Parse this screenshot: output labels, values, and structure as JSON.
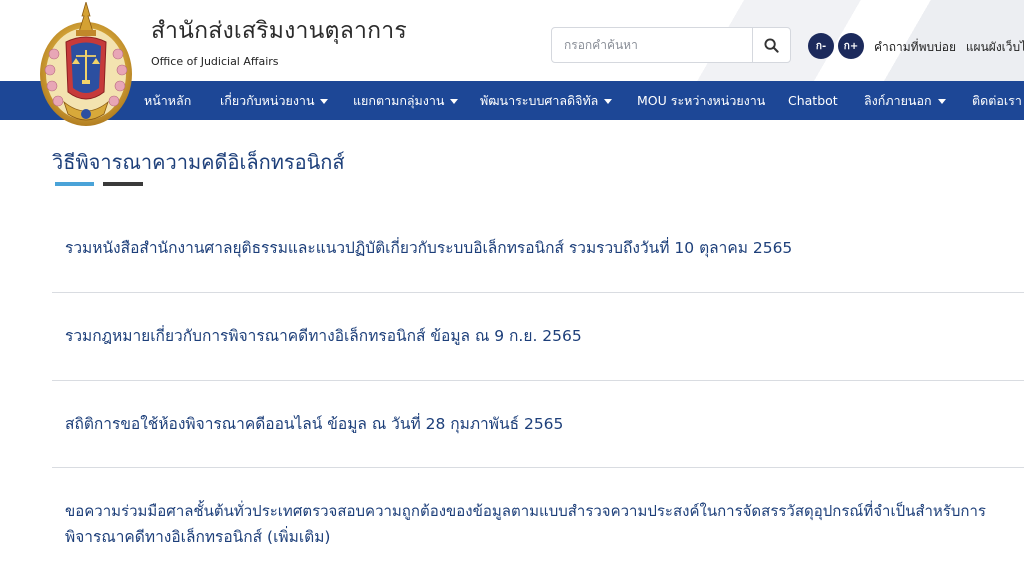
{
  "header": {
    "title": "สำนักส่งเสริมงานตุลาการ",
    "subtitle": "Office of Judicial Affairs",
    "logo_icon": "court-emblem-icon"
  },
  "search": {
    "placeholder": "กรอกคำค้นหา",
    "icon": "search-icon"
  },
  "font_size": {
    "decrease_label": "ก-",
    "increase_label": "ก+"
  },
  "top_links": {
    "faq": "คำถามที่พบบ่อย",
    "sitemap": "แผนผังเว็บไซ"
  },
  "nav": {
    "items": [
      {
        "label": "หน้าหลัก",
        "has_dropdown": false
      },
      {
        "label": "เกี่ยวกับหน่วยงาน",
        "has_dropdown": true
      },
      {
        "label": "แยกตามกลุ่มงาน",
        "has_dropdown": true
      },
      {
        "label": "พัฒนาระบบศาลดิจิทัล",
        "has_dropdown": true
      },
      {
        "label": "MOU ระหว่างหน่วยงาน",
        "has_dropdown": false
      },
      {
        "label": "Chatbot",
        "has_dropdown": false
      },
      {
        "label": "ลิงก์ภายนอก",
        "has_dropdown": true
      },
      {
        "label": "ติดต่อเรา",
        "has_dropdown": false
      }
    ]
  },
  "main": {
    "title": "วิธีพิจารณาความคดีอิเล็กทรอนิกส์",
    "items": [
      {
        "line1": "รวมหนังสือสำนักงานศาลยุติธรรมและแนวปฏิบัติเกี่ยวกับระบบอิเล็กทรอนิกส์ รวมรวบถึงวันที่ 10 ตุลาคม 2565",
        "line2": ""
      },
      {
        "line1": "รวมกฎหมายเกี่ยวกับการพิจารณาคดีทางอิเล็กทรอนิกส์ ข้อมูล ณ 9 ก.ย. 2565",
        "line2": ""
      },
      {
        "line1": "สถิติการขอใช้ห้องพิจารณาคดีออนไลน์ ข้อมูล ณ วันที่ 28 กุมภาพันธ์ 2565",
        "line2": ""
      },
      {
        "line1": "ขอความร่วมมือศาลชั้นต้นทั่วประเทศตรวจสอบความถูกต้องของข้อมูลตามแบบสำรวจความประสงค์ในการจัดสรรวัสดุอุปกรณ์ที่จำเป็นสำหรับการ",
        "line2": "พิจารณาคดีทางอิเล็กทรอนิกส์ (เพิ่มเติม)"
      }
    ]
  },
  "colors": {
    "nav_bg": "#1d4796",
    "link": "#1d3f7a",
    "accent_blue": "#4aa3d8",
    "accent_dark": "#3a3a3a",
    "font_btn": "#1c2a5c"
  }
}
